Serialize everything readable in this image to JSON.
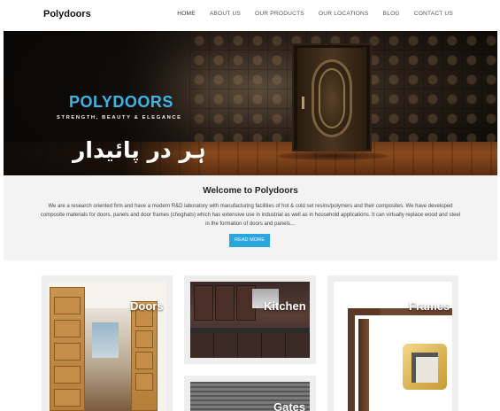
{
  "header": {
    "brand": "Polydoors",
    "nav": [
      {
        "label": "HOME"
      },
      {
        "label": "ABOUT US"
      },
      {
        "label": "OUR PRODUCTS"
      },
      {
        "label": "OUR LOCATIONS"
      },
      {
        "label": "BLOG"
      },
      {
        "label": "CONTACT US"
      }
    ],
    "active_nav_color": "#333333"
  },
  "hero": {
    "title": "POLYDOORS",
    "tagline": "STRENGTH, BEAUTY & ELEGANCE",
    "urdu": "ہر در پائیدار",
    "title_color": "#3fb4e6"
  },
  "welcome": {
    "title": "Welcome to Polydoors",
    "text": "We are a research oriented firm and have a modern R&D laboratory with manufacturing facilities of hot & cold set resins/polymers and their composites. We have developed composite materials for doors, panels and door frames (choghats) which has extensive use in industrial as well as in household applications. It can virtually replace wood and steel in the formation of doors and panels…",
    "button": "READ MORE",
    "button_color": "#2aa6dd"
  },
  "products": [
    {
      "label": "Doors"
    },
    {
      "label": "Kitchen"
    },
    {
      "label": "Frames"
    },
    {
      "label": "Gates"
    }
  ]
}
